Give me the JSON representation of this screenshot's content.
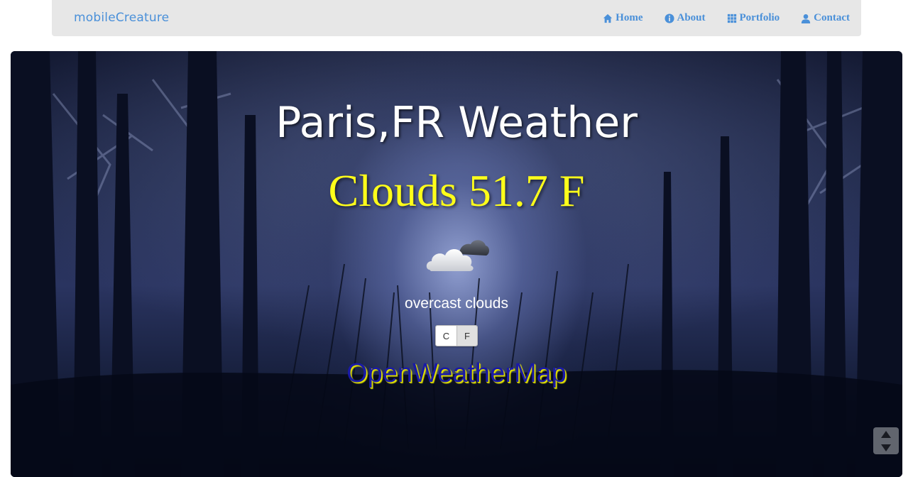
{
  "nav": {
    "brand": "mobileCreature",
    "links": [
      {
        "label": "Home",
        "icon": "home-icon"
      },
      {
        "label": "About",
        "icon": "info-icon"
      },
      {
        "label": "Portfolio",
        "icon": "grid-icon"
      },
      {
        "label": "Contact",
        "icon": "user-icon"
      }
    ]
  },
  "weather": {
    "title": "Paris,FR Weather",
    "condition": "Clouds 51.7 F",
    "icon": "overcast-clouds-icon",
    "description": "overcast clouds",
    "unit_celsius": "C",
    "unit_fahrenheit": "F",
    "selected_unit": "F",
    "provider": "OpenWeatherMap"
  },
  "colors": {
    "nav_bg": "#e7e7e7",
    "nav_link": "#4a90d9",
    "condition_text": "#ffff1a",
    "provider_text": "#1a1aa6"
  }
}
